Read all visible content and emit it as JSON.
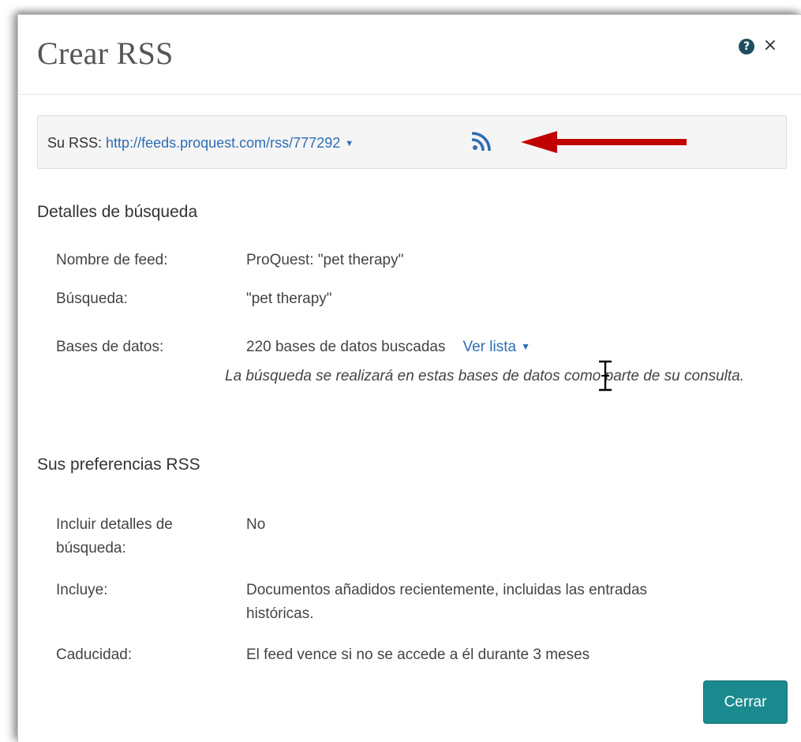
{
  "dialog": {
    "title": "Crear RSS",
    "help_icon_glyph": "?",
    "close_icon_glyph": "×"
  },
  "rss": {
    "label": "Su RSS:",
    "url": "http://feeds.proquest.com/rss/777292",
    "caret_glyph": "▼",
    "icon": "rss-feed-icon",
    "arrow_color": "#c00000"
  },
  "search_details": {
    "heading": "Detalles de búsqueda",
    "rows": [
      {
        "label": "Nombre de feed:",
        "value": "ProQuest: \"pet therapy\""
      },
      {
        "label": "Búsqueda:",
        "value": "\"pet therapy\""
      },
      {
        "label": "Bases de datos:",
        "value": "220 bases de datos buscadas"
      }
    ],
    "view_list_label": "Ver lista",
    "view_list_caret": "▼",
    "databases_note": "La búsqueda se realizará en estas bases de datos como parte de su consulta."
  },
  "preferences": {
    "heading": "Sus preferencias RSS",
    "rows": [
      {
        "label": "Incluir detalles de búsqueda:",
        "value": "No"
      },
      {
        "label": "Incluye:",
        "value": "Documentos añadidos recientemente, incluidas las entradas históricas."
      },
      {
        "label": "Caducidad:",
        "value": "El feed vence si no se accede a él durante 3 meses"
      }
    ]
  },
  "footer": {
    "close_button_label": "Cerrar"
  },
  "colors": {
    "link": "#2d6db5",
    "primary_button": "#1b8a8e",
    "rss_icon": "#2d6db5",
    "help_icon": "#1f4e5f"
  }
}
